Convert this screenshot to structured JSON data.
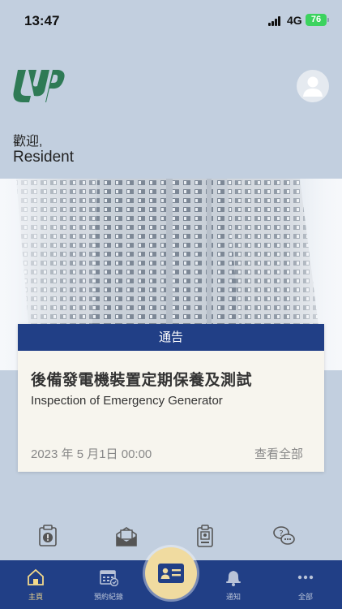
{
  "status": {
    "time": "13:47",
    "network": "4G",
    "battery": "76"
  },
  "header": {
    "greeting": "歡迎,",
    "user_name": "Resident"
  },
  "notice": {
    "header": "通告",
    "title_zh": "後備發電機裝置定期保養及測試",
    "title_en": "Inspection of Emergency Generator",
    "date": "2023 年 5 月1日 00:00",
    "more_label": "查看全部"
  },
  "quick_icons": [
    "clipboard-alert-icon",
    "mail-icon",
    "badge-icon",
    "chat-icon"
  ],
  "tabs": [
    {
      "label": "主頁",
      "icon": "home-icon",
      "active": true
    },
    {
      "label": "預約紀錄",
      "icon": "calendar-icon",
      "active": false
    },
    {
      "label": "通知",
      "icon": "bell-icon",
      "active": false
    },
    {
      "label": "全部",
      "icon": "more-icon",
      "active": false
    }
  ],
  "center_button": {
    "icon": "id-card-icon"
  },
  "colors": {
    "primary": "#213f86",
    "accent": "#f3d98a",
    "background": "#c2cfdf",
    "card": "#f7f5ee",
    "brand_green": "#2e7a55"
  }
}
